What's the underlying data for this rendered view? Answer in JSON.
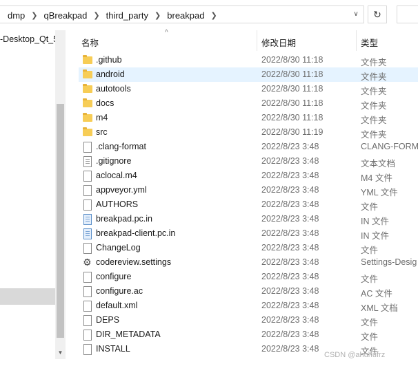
{
  "breadcrumbs": [
    "dmp",
    "qBreakpad",
    "third_party",
    "breakpad"
  ],
  "nav": {
    "item_label": "-Desktop_Qt_5"
  },
  "columns": {
    "name": "名称",
    "date": "修改日期",
    "type": "类型"
  },
  "files": [
    {
      "name": ".github",
      "date": "2022/8/30 11:18",
      "type": "文件夹",
      "icon": "folder-icon"
    },
    {
      "name": "android",
      "date": "2022/8/30 11:18",
      "type": "文件夹",
      "icon": "folder-icon"
    },
    {
      "name": "autotools",
      "date": "2022/8/30 11:18",
      "type": "文件夹",
      "icon": "folder-icon"
    },
    {
      "name": "docs",
      "date": "2022/8/30 11:18",
      "type": "文件夹",
      "icon": "folder-icon"
    },
    {
      "name": "m4",
      "date": "2022/8/30 11:18",
      "type": "文件夹",
      "icon": "folder-icon"
    },
    {
      "name": "src",
      "date": "2022/8/30 11:19",
      "type": "文件夹",
      "icon": "folder-icon"
    },
    {
      "name": ".clang-format",
      "date": "2022/8/23 3:48",
      "type": "CLANG-FORMA",
      "icon": "file-icon"
    },
    {
      "name": ".gitignore",
      "date": "2022/8/23 3:48",
      "type": "文本文档",
      "icon": "text-file-icon"
    },
    {
      "name": "aclocal.m4",
      "date": "2022/8/23 3:48",
      "type": "M4 文件",
      "icon": "file-icon"
    },
    {
      "name": "appveyor.yml",
      "date": "2022/8/23 3:48",
      "type": "YML 文件",
      "icon": "file-icon"
    },
    {
      "name": "AUTHORS",
      "date": "2022/8/23 3:48",
      "type": "文件",
      "icon": "file-icon"
    },
    {
      "name": "breakpad.pc.in",
      "date": "2022/8/23 3:48",
      "type": "IN 文件",
      "icon": "in-file-icon"
    },
    {
      "name": "breakpad-client.pc.in",
      "date": "2022/8/23 3:48",
      "type": "IN 文件",
      "icon": "in-file-icon"
    },
    {
      "name": "ChangeLog",
      "date": "2022/8/23 3:48",
      "type": "文件",
      "icon": "file-icon"
    },
    {
      "name": "codereview.settings",
      "date": "2022/8/23 3:48",
      "type": "Settings-Desig",
      "icon": "settings-gear-icon"
    },
    {
      "name": "configure",
      "date": "2022/8/23 3:48",
      "type": "文件",
      "icon": "file-icon"
    },
    {
      "name": "configure.ac",
      "date": "2022/8/23 3:48",
      "type": "AC 文件",
      "icon": "file-icon"
    },
    {
      "name": "default.xml",
      "date": "2022/8/23 3:48",
      "type": "XML 文档",
      "icon": "file-icon"
    },
    {
      "name": "DEPS",
      "date": "2022/8/23 3:48",
      "type": "文件",
      "icon": "file-icon"
    },
    {
      "name": "DIR_METADATA",
      "date": "2022/8/23 3:48",
      "type": "文件",
      "icon": "file-icon"
    },
    {
      "name": "INSTALL",
      "date": "2022/8/23 3:48",
      "type": "文件",
      "icon": "file-icon"
    }
  ],
  "highlighted_row": 1,
  "watermark": "CSDN @ahuhufrz"
}
